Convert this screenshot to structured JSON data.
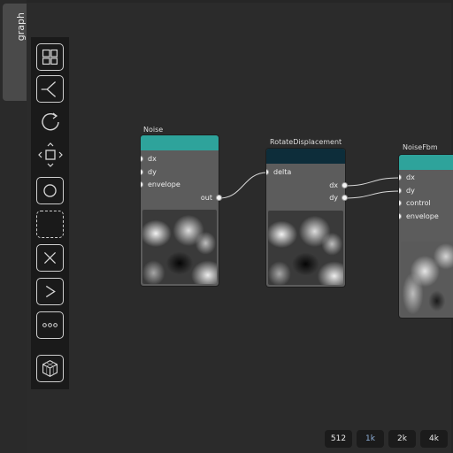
{
  "side_tab": {
    "label": "graph"
  },
  "toolbar": {
    "tools": [
      {
        "name": "grid-layout-icon"
      },
      {
        "name": "branch-icon"
      },
      {
        "name": "rotate-icon"
      },
      {
        "name": "move-icon"
      },
      {
        "name": "circle-icon"
      },
      {
        "name": "empty-frame-icon"
      },
      {
        "name": "cross-icon"
      },
      {
        "name": "chevron-right-icon"
      },
      {
        "name": "ellipsis-icon"
      },
      {
        "name": "cube-icon"
      }
    ]
  },
  "nodes": {
    "noise": {
      "title": "Noise",
      "header_color": "#2ea39b",
      "inputs": [
        "dx",
        "dy",
        "envelope"
      ],
      "output": "out"
    },
    "rotate": {
      "title": "RotateDisplacement",
      "header_color": "#0d2d3a",
      "input": "delta",
      "outputs": [
        "dx",
        "dy"
      ]
    },
    "noisefbm": {
      "title": "NoiseFbm",
      "header_color": "#2ea39b",
      "inputs": [
        "dx",
        "dy",
        "control",
        "envelope"
      ]
    }
  },
  "resolution": {
    "options": [
      "512",
      "1k",
      "2k",
      "4k"
    ],
    "selected": "1k"
  }
}
